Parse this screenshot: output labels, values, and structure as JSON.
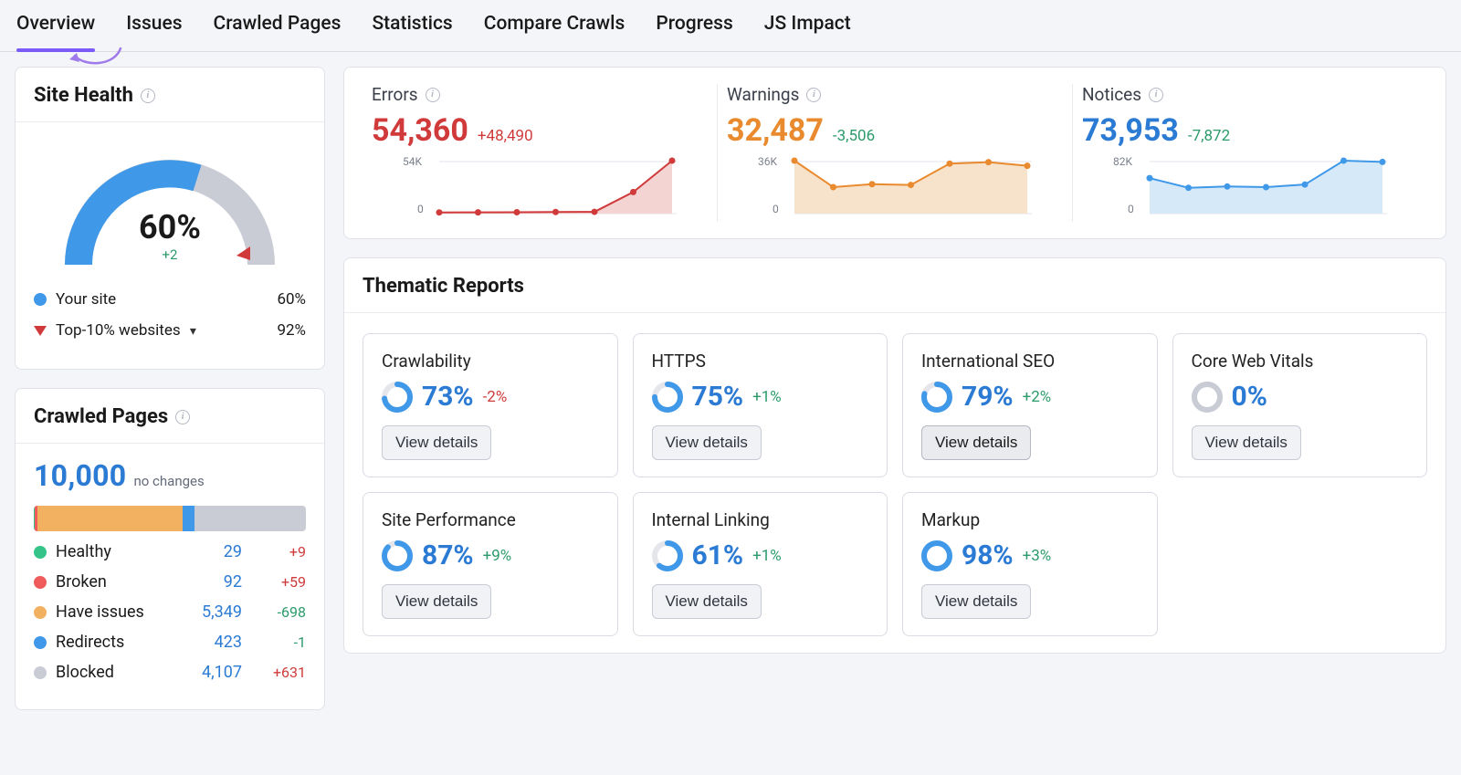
{
  "tabs": [
    "Overview",
    "Issues",
    "Crawled Pages",
    "Statistics",
    "Compare Crawls",
    "Progress",
    "JS Impact"
  ],
  "active_tab": 0,
  "site_health": {
    "title": "Site Health",
    "value": "60%",
    "delta": "+2",
    "legend": {
      "your_site": {
        "label": "Your site",
        "pct": "60%",
        "color": "#3f98e8"
      },
      "top10": {
        "label": "Top-10% websites",
        "pct": "92%"
      }
    }
  },
  "crawled_pages": {
    "title": "Crawled Pages",
    "total": "10,000",
    "no_changes": "no changes",
    "bar_colors": {
      "healthy": "#36c38a",
      "broken": "#ef5b5b",
      "issues": "#f2b161",
      "redirects": "#3f98e8",
      "blocked": "#c9ccd4"
    },
    "segments": [
      {
        "key": "healthy",
        "pct": 0.29
      },
      {
        "key": "broken",
        "pct": 0.92
      },
      {
        "key": "issues",
        "pct": 53.49
      },
      {
        "key": "redirects",
        "pct": 4.23
      },
      {
        "key": "blocked",
        "pct": 41.07
      }
    ],
    "rows": [
      {
        "key": "healthy",
        "label": "Healthy",
        "value": "29",
        "delta": "+9",
        "delta_sign": "pos"
      },
      {
        "key": "broken",
        "label": "Broken",
        "value": "92",
        "delta": "+59",
        "delta_sign": "pos"
      },
      {
        "key": "issues",
        "label": "Have issues",
        "value": "5,349",
        "delta": "-698",
        "delta_sign": "neg"
      },
      {
        "key": "redirects",
        "label": "Redirects",
        "value": "423",
        "delta": "-1",
        "delta_sign": "neg"
      },
      {
        "key": "blocked",
        "label": "Blocked",
        "value": "4,107",
        "delta": "+631",
        "delta_sign": "pos"
      }
    ]
  },
  "kpis": [
    {
      "key": "errors",
      "title": "Errors",
      "value": "54,360",
      "delta": "+48,490",
      "axis_top": "54K",
      "axis_bot": "0",
      "color": "#d03a3a",
      "fill": "#f4d3d3"
    },
    {
      "key": "warnings",
      "title": "Warnings",
      "value": "32,487",
      "delta": "-3,506",
      "axis_top": "36K",
      "axis_bot": "0",
      "color": "#e98a2e",
      "fill": "#f7e3cc"
    },
    {
      "key": "notices",
      "title": "Notices",
      "value": "73,953",
      "delta": "-7,872",
      "axis_top": "82K",
      "axis_bot": "0",
      "color": "#3f98e8",
      "fill": "#d6e9f8"
    }
  ],
  "chart_data": {
    "sparklines": [
      {
        "name": "Errors",
        "type": "area",
        "ylim": [
          0,
          54000
        ],
        "y": [
          1200,
          1300,
          1400,
          1600,
          1800,
          22000,
          54000
        ]
      },
      {
        "name": "Warnings",
        "type": "area",
        "ylim": [
          0,
          36000
        ],
        "y": [
          36000,
          18000,
          20000,
          19500,
          34000,
          35000,
          32500
        ]
      },
      {
        "name": "Notices",
        "type": "area",
        "ylim": [
          0,
          82000
        ],
        "y": [
          55000,
          40000,
          42000,
          41000,
          45000,
          82000,
          80000
        ]
      }
    ],
    "gauge": {
      "type": "gauge",
      "value_pct": 60,
      "marker_pct": 92,
      "ylim": [
        0,
        100
      ]
    }
  },
  "thematic": {
    "title": "Thematic Reports",
    "button_label": "View details",
    "reports": [
      {
        "name": "Crawlability",
        "pct": "73%",
        "pctNum": 73,
        "delta": "-2%",
        "delta_sign": "neg"
      },
      {
        "name": "HTTPS",
        "pct": "75%",
        "pctNum": 75,
        "delta": "+1%",
        "delta_sign": "pos"
      },
      {
        "name": "International SEO",
        "pct": "79%",
        "pctNum": 79,
        "delta": "+2%",
        "delta_sign": "pos",
        "hover": true
      },
      {
        "name": "Core Web Vitals",
        "pct": "0%",
        "pctNum": 0,
        "delta": "",
        "delta_sign": ""
      },
      {
        "name": "Site Performance",
        "pct": "87%",
        "pctNum": 87,
        "delta": "+9%",
        "delta_sign": "pos"
      },
      {
        "name": "Internal Linking",
        "pct": "61%",
        "pctNum": 61,
        "delta": "+1%",
        "delta_sign": "pos"
      },
      {
        "name": "Markup",
        "pct": "98%",
        "pctNum": 98,
        "delta": "+3%",
        "delta_sign": "pos"
      }
    ]
  }
}
